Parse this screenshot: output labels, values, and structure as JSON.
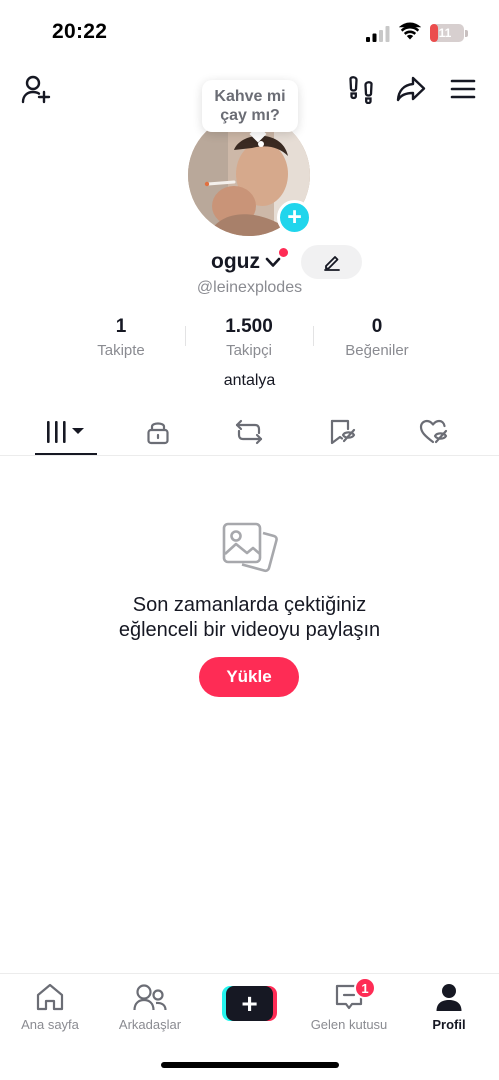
{
  "status_bar": {
    "time": "20:22",
    "battery_level": "11",
    "battery_fraction": 0.11
  },
  "header": {
    "icons": [
      "add-friend-icon",
      "footprints-icon",
      "share-icon",
      "menu-icon"
    ]
  },
  "profile": {
    "bubble_line1": "Kahve mi",
    "bubble_line2": "çay mı?",
    "username": "oguz",
    "handle": "@leinexplodes",
    "bio": "antalya"
  },
  "stats": [
    {
      "value": "1",
      "label": "Takipte"
    },
    {
      "value": "1.500",
      "label": "Takipçi"
    },
    {
      "value": "0",
      "label": "Beğeniler"
    }
  ],
  "tabs": [
    "videos-grid-icon",
    "lock-icon",
    "repost-icon",
    "favorites-icon",
    "liked-icon"
  ],
  "empty_state": {
    "line1": "Son zamanlarda çektiğiniz",
    "line2": "eğlenceli bir videoyu paylaşın",
    "button": "Yükle"
  },
  "bottom_nav": {
    "home": "Ana sayfa",
    "friends": "Arkadaşlar",
    "inbox": "Gelen kutusu",
    "inbox_badge": "1",
    "profile": "Profil"
  },
  "colors": {
    "accent": "#fe2c55",
    "cyan": "#25f4ee",
    "add_badge": "#20d5ec",
    "text": "#161823",
    "muted": "#8a8b91"
  }
}
